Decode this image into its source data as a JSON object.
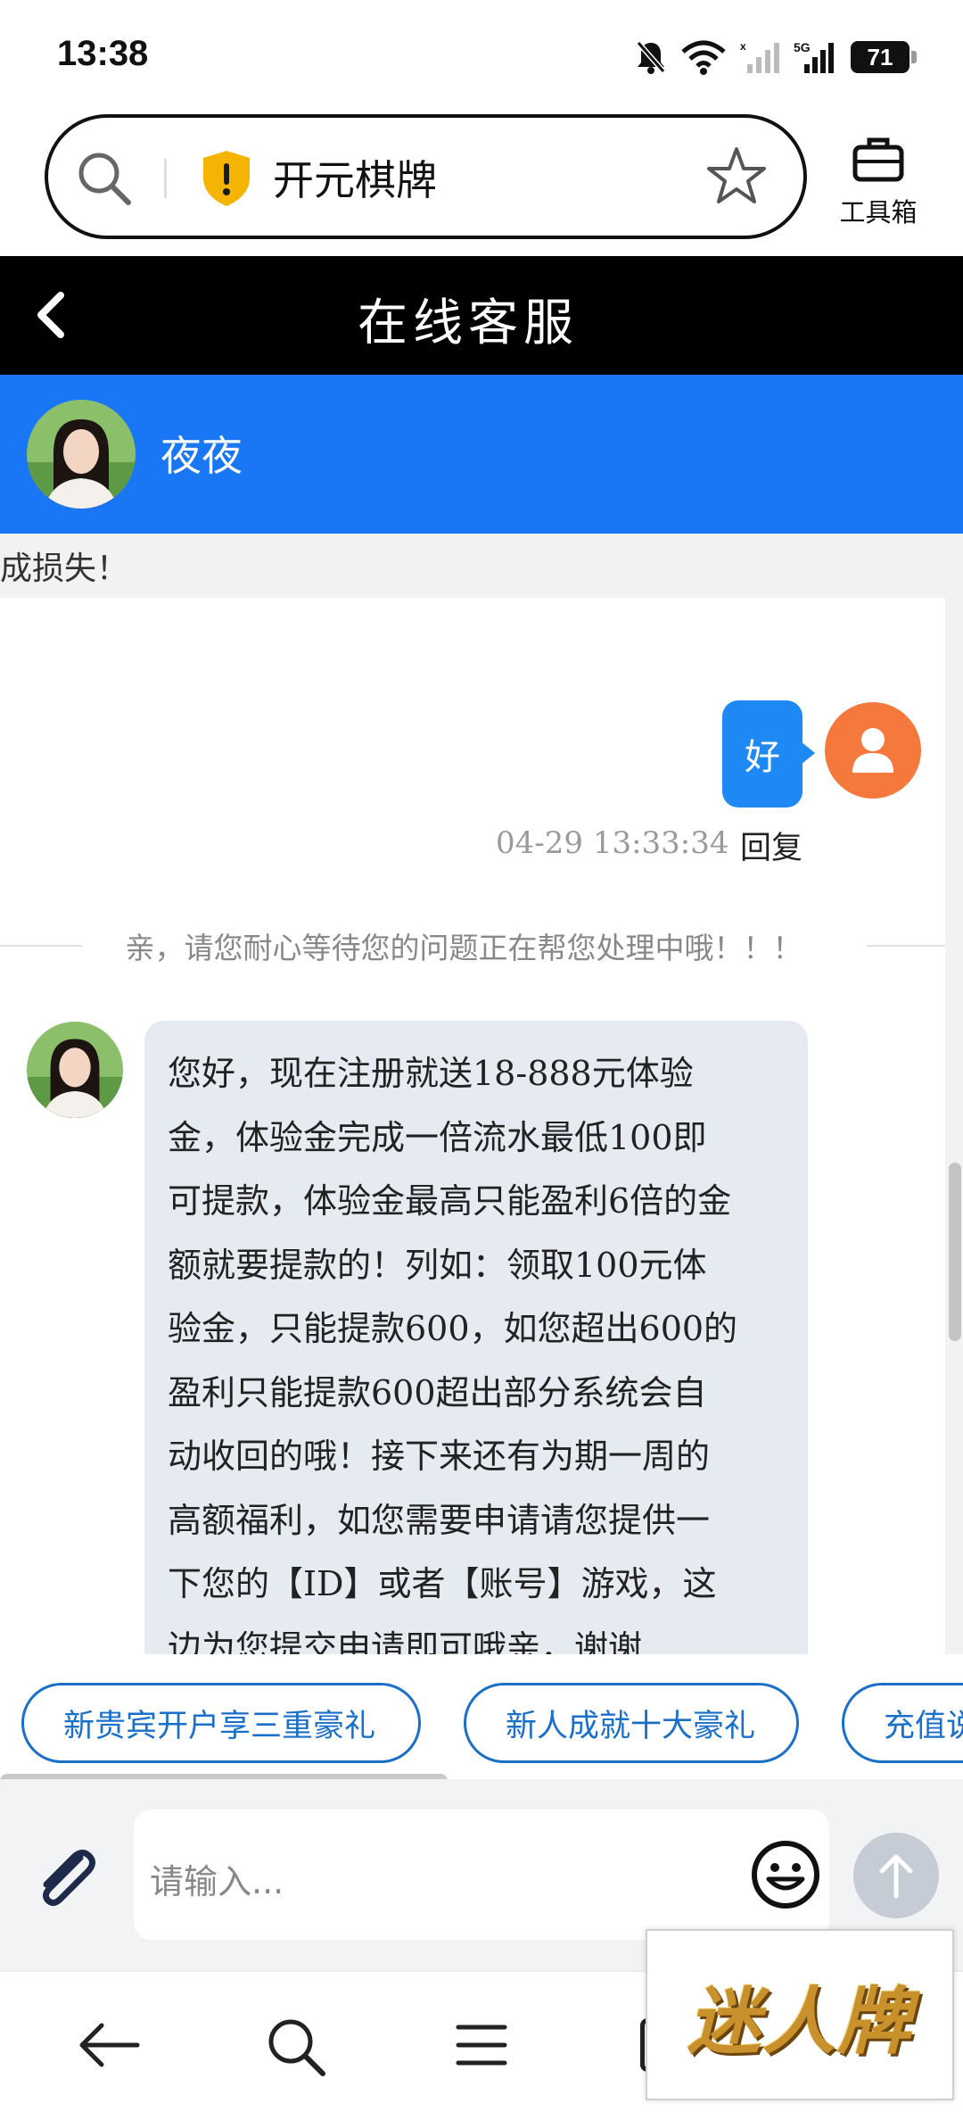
{
  "status_bar": {
    "time": "13:38",
    "network": "5G",
    "battery": "71",
    "icons": [
      "bell-muted-icon",
      "wifi-icon",
      "signal-icon",
      "battery-icon"
    ]
  },
  "browser": {
    "url_text": "开元棋牌",
    "toolbox_label": "工具箱",
    "icons": [
      "search-icon",
      "shield-warning-icon",
      "star-icon",
      "toolbox-icon"
    ]
  },
  "header": {
    "title": "在线客服"
  },
  "agent": {
    "name": "夜夜"
  },
  "chat": {
    "previous_fragment": "成损失！",
    "user_message": {
      "text": "好",
      "time": "04-29 13:33:34",
      "reply_label": "回复"
    },
    "system_notice": "亲，请您耐心等待您的问题正在帮您处理中哦！！！",
    "agent_message": {
      "lines": [
        "您好，现在注册就送18-888元体验",
        "金，体验金完成一倍流水最低100即",
        "可提款，体验金最高只能盈利6倍的金",
        "额就要提款的！列如：领取100元体",
        "验金，只能提款600，如您超出600的",
        "盈利只能提款600超出部分系统会自",
        "动收回的哦！接下来还有为期一周的",
        "高额福利，如您需要申请请您提供一",
        "下您的【ID】或者【账号】游戏，这",
        "边为您提交申请即可哦亲，谢谢"
      ]
    }
  },
  "quick_replies": [
    {
      "label": "新贵宾开户享三重豪礼"
    },
    {
      "label": "新人成就十大豪礼"
    },
    {
      "label": "充值说"
    }
  ],
  "input": {
    "placeholder": "请输入..."
  },
  "watermark": {
    "text": "迷人牌"
  },
  "colors": {
    "agent_bar": "#1976f5",
    "user_bubble": "#1e88f5",
    "user_avatar": "#f5793c",
    "agent_bubble": "#e6ebf2",
    "chip_border": "#1a6fc8"
  }
}
